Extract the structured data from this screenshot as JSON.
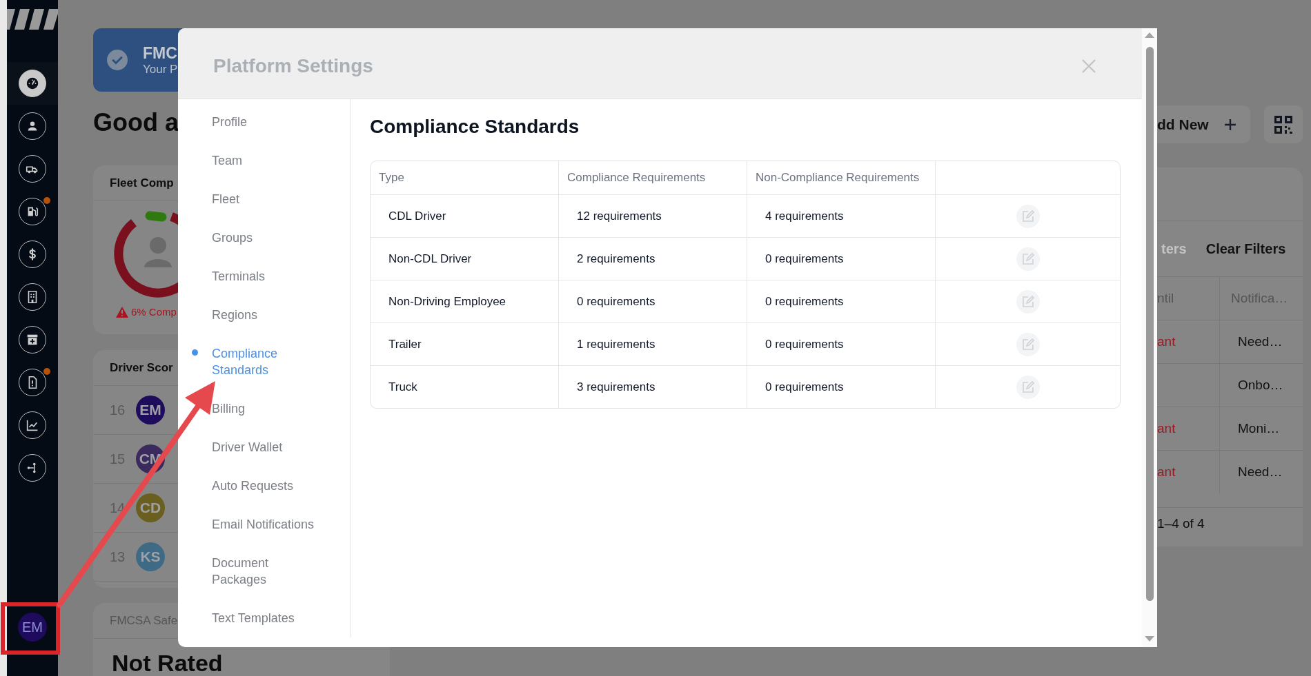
{
  "sidebar": {
    "items": [
      {
        "selected": true,
        "badge": false
      },
      {
        "selected": false,
        "badge": false
      },
      {
        "selected": false,
        "badge": false
      },
      {
        "selected": false,
        "badge": true
      },
      {
        "selected": false,
        "badge": false
      },
      {
        "selected": false,
        "badge": false
      },
      {
        "selected": false,
        "badge": false
      },
      {
        "selected": false,
        "badge": true
      },
      {
        "selected": false,
        "badge": false
      },
      {
        "selected": false,
        "badge": false
      }
    ],
    "user": {
      "initials": "EM"
    }
  },
  "banner": {
    "title": "FMC",
    "subtitle": "Your P"
  },
  "greeting": "Good a",
  "fleet_card": {
    "title": "Fleet Comp",
    "status": "6% Comp"
  },
  "driver_card": {
    "title": "Driver Scor",
    "rows": [
      {
        "rank": "16",
        "initials": "EM",
        "color": "#1f0c5c"
      },
      {
        "rank": "15",
        "initials": "CM",
        "color": "#3b2a5e"
      },
      {
        "rank": "14",
        "initials": "CD",
        "color": "#6b5f20"
      },
      {
        "rank": "13",
        "initials": "KS",
        "color": "#3e6a86"
      }
    ]
  },
  "safety_card": {
    "title": "FMCSA Safe",
    "rating": "Not Rated"
  },
  "toolbar": {
    "add_button": "dd New"
  },
  "records_card": {
    "filter_button": "ters",
    "clear_button": "Clear Filters",
    "columns": [
      "ntil",
      "Notifica…"
    ],
    "rows": [
      {
        "column_1": "ant",
        "column_2": "Need…"
      },
      {
        "column_2": "Onbo…"
      },
      {
        "column_1": "ant",
        "column_2": "Moni…"
      },
      {
        "column_1": "ant",
        "column_2": "Need…"
      }
    ],
    "pagination": "1–4 of 4"
  },
  "modal": {
    "title": "Platform Settings",
    "nav": [
      {
        "label": "Profile",
        "selected": false
      },
      {
        "label": "Team",
        "selected": false
      },
      {
        "label": "Fleet",
        "selected": false
      },
      {
        "label": "Groups",
        "selected": false
      },
      {
        "label": "Terminals",
        "selected": false
      },
      {
        "label": "Regions",
        "selected": false
      },
      {
        "label": "Compliance Standards",
        "selected": true
      },
      {
        "label": "Billing",
        "selected": false
      },
      {
        "label": "Driver Wallet",
        "selected": false
      },
      {
        "label": "Auto Requests",
        "selected": false
      },
      {
        "label": "Email Notifications",
        "selected": false
      },
      {
        "label": "Document Packages",
        "selected": false
      },
      {
        "label": "Text Templates",
        "selected": false
      }
    ],
    "section_title": "Compliance Standards",
    "table": {
      "columns": [
        "Type",
        "Compliance Requirements",
        "Non-Compliance Requirements"
      ],
      "rows": [
        {
          "type": "CDL Driver",
          "compliance": "12 requirements",
          "non_compliance": "4 requirements"
        },
        {
          "type": "Non-CDL Driver",
          "compliance": "2 requirements",
          "non_compliance": "0 requirements"
        },
        {
          "type": "Non-Driving Employee",
          "compliance": "0 requirements",
          "non_compliance": "0 requirements"
        },
        {
          "type": "Trailer",
          "compliance": "1 requirements",
          "non_compliance": "0 requirements"
        },
        {
          "type": "Truck",
          "compliance": "3 requirements",
          "non_compliance": "0 requirements"
        }
      ]
    }
  }
}
